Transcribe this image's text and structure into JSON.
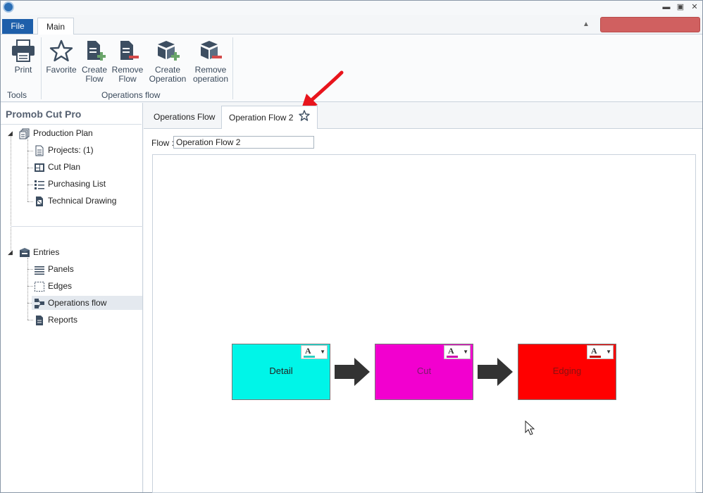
{
  "window": {
    "minimize_glyph": "▬",
    "maximize_glyph": "▣",
    "close_glyph": "✕"
  },
  "menubar": {
    "file_label": "File",
    "main_tab_label": "Main"
  },
  "ribbon": {
    "groups": [
      {
        "label": "Tools"
      },
      {
        "label": "Operations flow"
      }
    ],
    "buttons": {
      "print": {
        "line1": "Print",
        "line2": ""
      },
      "favorite": {
        "line1": "Favorite",
        "line2": ""
      },
      "create_flow": {
        "line1": "Create",
        "line2": "Flow"
      },
      "remove_flow": {
        "line1": "Remove",
        "line2": "Flow"
      },
      "create_operation": {
        "line1": "Create",
        "line2": "Operation"
      },
      "remove_operation": {
        "line1": "Remove",
        "line2": "operation"
      }
    }
  },
  "left_panel": {
    "title": "Promob Cut Pro",
    "production_plan": "Production Plan",
    "projects": "Projects: (1)",
    "cut_plan": "Cut Plan",
    "purchasing_list": "Purchasing List",
    "technical_drawing": "Technical Drawing",
    "entries": "Entries",
    "panels": "Panels",
    "edges": "Edges",
    "operations_flow": "Operations flow",
    "reports": "Reports"
  },
  "doc_tabs": [
    {
      "label": "Operations Flow"
    },
    {
      "label": "Operation Flow 2"
    }
  ],
  "flow": {
    "label": "Flow :",
    "value": "Operation Flow 2"
  },
  "operations": [
    {
      "label": "Detail",
      "color": "#00f5e8",
      "swatch": "#2ad0c0",
      "text_color": "#222222"
    },
    {
      "label": "Cut",
      "color": "#f200cf",
      "swatch": "#d000b0",
      "text_color": "#7a1a6a"
    },
    {
      "label": "Edging",
      "color": "#ff0000",
      "swatch": "#c00000",
      "text_color": "#8a1010"
    }
  ],
  "colors": {
    "file_button": "#1e5faa",
    "annotation_arrow": "#e8141c",
    "flow_arrow": "#333333"
  }
}
